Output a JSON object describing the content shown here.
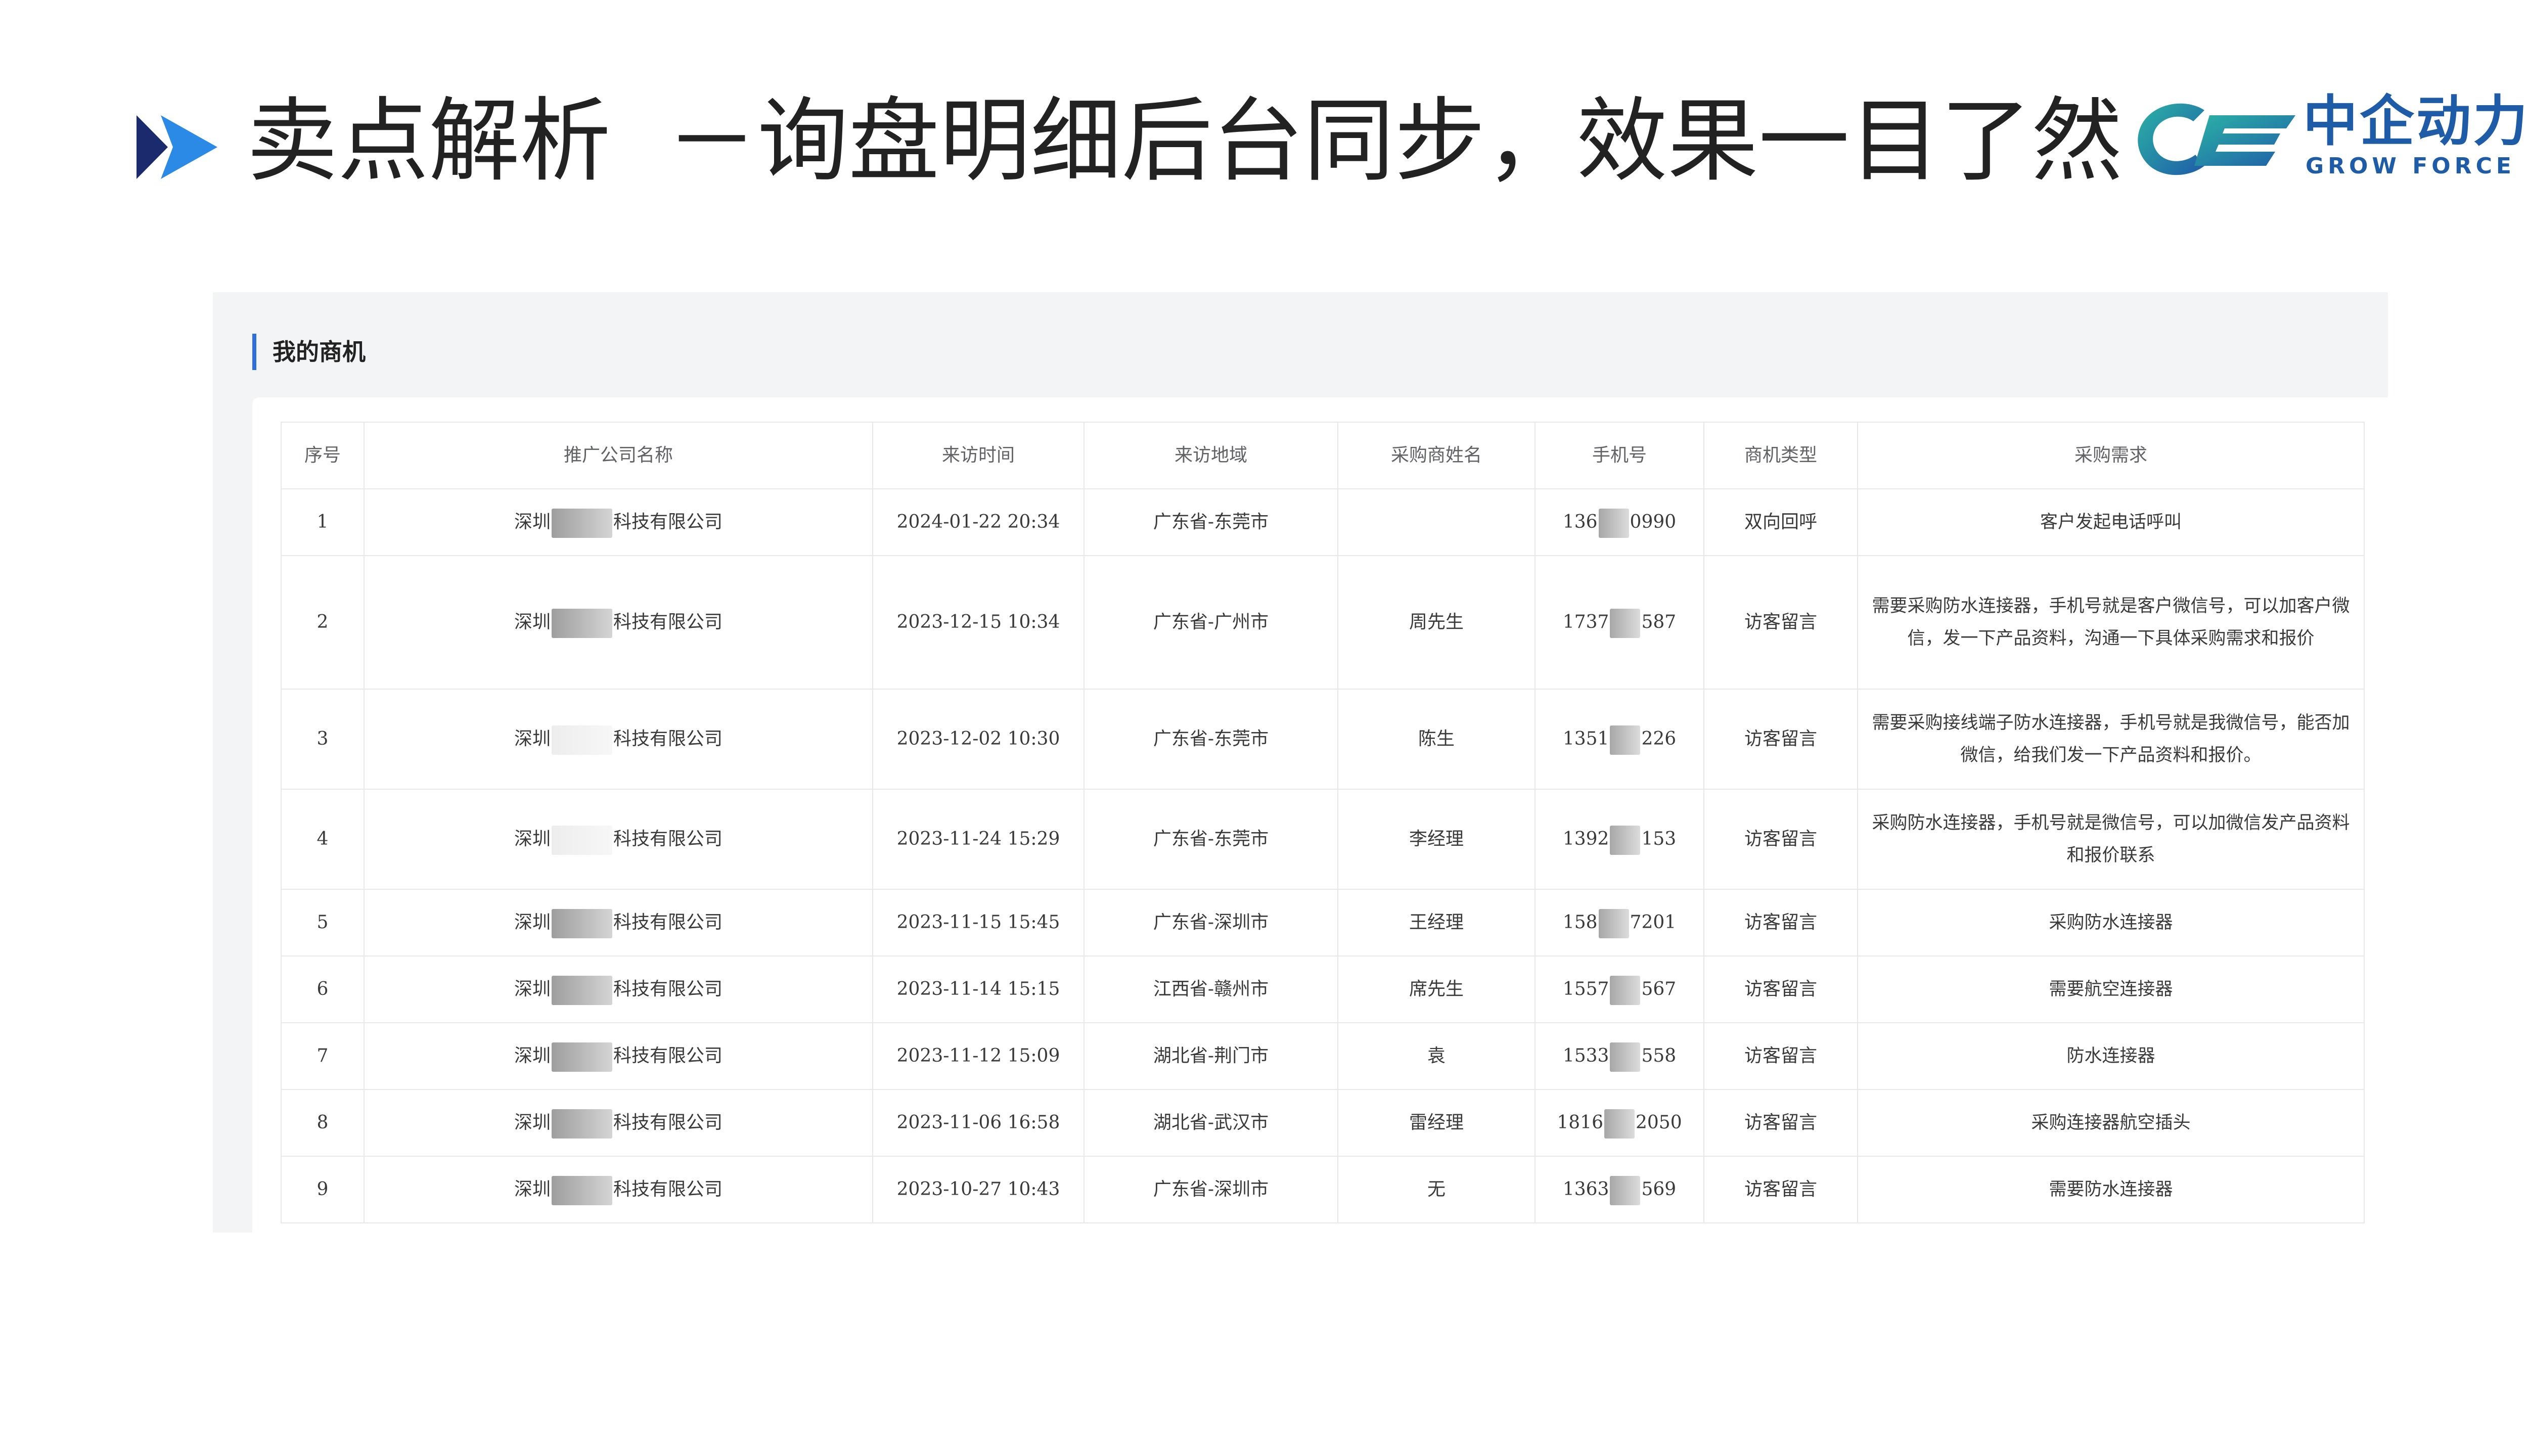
{
  "header": {
    "title_main": "卖点解析",
    "title_sub": "－询盘明细后台同步，效果一目了然",
    "logo_cn": "中企动力",
    "logo_en": "GROW FORCE"
  },
  "panel": {
    "title": "我的商机",
    "accent_color": "#2d6fdc"
  },
  "table": {
    "columns": [
      "序号",
      "推广公司名称",
      "来访时间",
      "来访地域",
      "采购商姓名",
      "手机号",
      "商机类型",
      "采购需求"
    ],
    "rows": [
      {
        "index": "1",
        "company_prefix": "深圳",
        "company_suffix": "科技有限公司",
        "time": "2024-01-22 20:34",
        "region": "广东省-东莞市",
        "name": "",
        "phone_prefix": "136",
        "phone_suffix": "0990",
        "type": "双向回呼",
        "demand": "客户发起电话呼叫"
      },
      {
        "index": "2",
        "company_prefix": "深圳",
        "company_suffix": "科技有限公司",
        "time": "2023-12-15 10:34",
        "region": "广东省-广州市",
        "name": "周先生",
        "phone_prefix": "1737",
        "phone_suffix": "587",
        "type": "访客留言",
        "demand": "需要采购防水连接器，手机号就是客户微信号，可以加客户微信，发一下产品资料，沟通一下具体采购需求和报价"
      },
      {
        "index": "3",
        "company_prefix": "深圳",
        "company_suffix": "科技有限公司",
        "time": "2023-12-02 10:30",
        "region": "广东省-东莞市",
        "name": "陈生",
        "phone_prefix": "1351",
        "phone_suffix": "226",
        "type": "访客留言",
        "demand": "需要采购接线端子防水连接器，手机号就是我微信号，能否加微信，给我们发一下产品资料和报价。"
      },
      {
        "index": "4",
        "company_prefix": "深圳",
        "company_suffix": "科技有限公司",
        "time": "2023-11-24 15:29",
        "region": "广东省-东莞市",
        "name": "李经理",
        "phone_prefix": "1392",
        "phone_suffix": "153",
        "type": "访客留言",
        "demand": "采购防水连接器，手机号就是微信号，可以加微信发产品资料和报价联系"
      },
      {
        "index": "5",
        "company_prefix": "深圳",
        "company_suffix": "科技有限公司",
        "time": "2023-11-15 15:45",
        "region": "广东省-深圳市",
        "name": "王经理",
        "phone_prefix": "158",
        "phone_suffix": "7201",
        "type": "访客留言",
        "demand": "采购防水连接器"
      },
      {
        "index": "6",
        "company_prefix": "深圳",
        "company_suffix": "科技有限公司",
        "time": "2023-11-14 15:15",
        "region": "江西省-赣州市",
        "name": "席先生",
        "phone_prefix": "1557",
        "phone_suffix": "567",
        "type": "访客留言",
        "demand": "需要航空连接器"
      },
      {
        "index": "7",
        "company_prefix": "深圳",
        "company_suffix": "科技有限公司",
        "time": "2023-11-12 15:09",
        "region": "湖北省-荆门市",
        "name": "袁",
        "phone_prefix": "1533",
        "phone_suffix": "558",
        "type": "访客留言",
        "demand": "防水连接器"
      },
      {
        "index": "8",
        "company_prefix": "深圳",
        "company_suffix": "科技有限公司",
        "time": "2023-11-06 16:58",
        "region": "湖北省-武汉市",
        "name": "雷经理",
        "phone_prefix": "1816",
        "phone_suffix": "2050",
        "type": "访客留言",
        "demand": "采购连接器航空插头"
      },
      {
        "index": "9",
        "company_prefix": "深圳",
        "company_suffix": "科技有限公司",
        "time": "2023-10-27 10:43",
        "region": "广东省-深圳市",
        "name": "无",
        "phone_prefix": "1363",
        "phone_suffix": "569",
        "type": "访客留言",
        "demand": "需要防水连接器"
      }
    ]
  }
}
